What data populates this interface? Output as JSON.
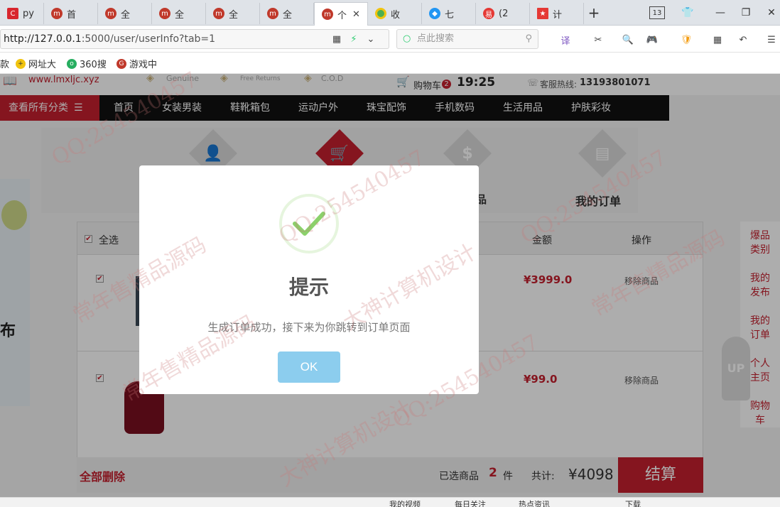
{
  "browser": {
    "tabs": [
      {
        "label": "py",
        "icon_color": "#d8262e",
        "icon_name": "c-logo-icon"
      },
      {
        "label": "首",
        "icon_color": "#c0392b",
        "icon_name": "site-logo-icon"
      },
      {
        "label": "全",
        "icon_color": "#c0392b",
        "icon_name": "site-logo-icon"
      },
      {
        "label": "全",
        "icon_color": "#c0392b",
        "icon_name": "site-logo-icon"
      },
      {
        "label": "全",
        "icon_color": "#c0392b",
        "icon_name": "site-logo-icon"
      },
      {
        "label": "全",
        "icon_color": "#c0392b",
        "icon_name": "site-logo-icon"
      },
      {
        "label": "个",
        "icon_color": "#c0392b",
        "icon_name": "site-logo-icon",
        "active": true
      },
      {
        "label": "收",
        "icon_color": "#4caf50",
        "icon_name": "chrome-logo-icon"
      },
      {
        "label": "七",
        "icon_color": "#2196f3",
        "icon_name": "bird-logo-icon"
      },
      {
        "label": "(2",
        "icon_color": "#e53935",
        "icon_name": "163-logo-icon"
      },
      {
        "label": "计",
        "icon_color": "#e53935",
        "icon_name": "flag-logo-icon"
      }
    ],
    "new_tab_symbol": "+",
    "tab_counter": "13",
    "url": {
      "host": "http://127.0.0.1",
      "rest": ":5000/user/userInfo?tab=1"
    },
    "search_placeholder": "点此搜索",
    "bookmarks": [
      {
        "label": "款",
        "icon_color": "#ffffff",
        "icon_name": "none"
      },
      {
        "label": "网址大",
        "icon_color": "#f1c40f",
        "icon_name": "plus-logo-icon"
      },
      {
        "label": "360搜",
        "icon_color": "#27ae60",
        "icon_name": "360-logo-icon"
      },
      {
        "label": "游戏中",
        "icon_color": "#c0392b",
        "icon_name": "game-logo-icon"
      }
    ],
    "status_items": [
      "我的视频",
      "每日关注",
      "热点资讯",
      "下载"
    ]
  },
  "site": {
    "domain": "www.lmxljc.xyz",
    "badges": [
      "Genuine",
      "Free Returns",
      "C.O.D"
    ],
    "cart_label": "购物车",
    "cart_count": "2",
    "time": "19:25",
    "hotline_label": "客服热线:",
    "hotline": "13193801071",
    "all_categories": "查看所有分类",
    "nav": [
      "首页",
      "女装男装",
      "鞋靴箱包",
      "运动户外",
      "珠宝配饰",
      "手机数码",
      "生活用品",
      "护肤彩妆"
    ],
    "user_tabs": [
      {
        "label": "",
        "icon": "user-icon"
      },
      {
        "label": "",
        "icon": "cart-icon"
      },
      {
        "label": "品",
        "icon": "dollar-icon"
      },
      {
        "label": "我的订单",
        "icon": "order-list-icon"
      }
    ],
    "left_banner_text": "布"
  },
  "cart": {
    "select_all": "全选",
    "col_amount": "金额",
    "col_action": "操作",
    "items": [
      {
        "amount": "¥3999.0",
        "remove": "移除商品",
        "checked": true
      },
      {
        "amount": "¥99.0",
        "remove": "移除商品",
        "checked": true
      }
    ],
    "delete_all": "全部删除",
    "selected_label": "已选商品",
    "selected_count": "2",
    "selected_unit": "件",
    "total_label": "共计:",
    "total": "¥4098",
    "checkout": "结算"
  },
  "right_panel": [
    "爆品类别",
    "我的发布",
    "我的订单",
    "个人主页",
    "购物车"
  ],
  "up_label": "UP",
  "dialog": {
    "title": "提示",
    "message": "生成订单成功，接下来为你跳转到订单页面",
    "ok": "OK"
  },
  "watermarks": [
    "QQ:254540457",
    "常年售精品源码",
    "大神计算机设计"
  ]
}
